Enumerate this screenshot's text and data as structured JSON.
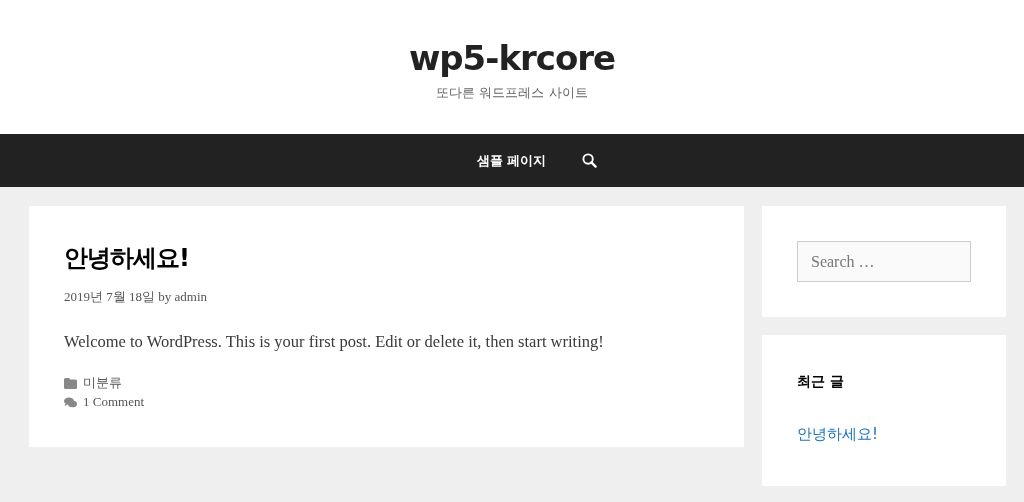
{
  "site": {
    "title": "wp5-krcore",
    "tagline": "또다른 워드프레스 사이트"
  },
  "nav": {
    "items": [
      {
        "label": "샘플 페이지"
      }
    ]
  },
  "post": {
    "title": "안녕하세요!",
    "meta": "2019년 7월 18일 by admin",
    "body": "Welcome to WordPress. This is your first post. Edit or delete it, then start writing!",
    "category": "미분류",
    "comments": "1 Comment"
  },
  "sidebar": {
    "search": {
      "placeholder": "Search …"
    },
    "recent": {
      "title": "최근 글",
      "items": [
        "안녕하세요!"
      ]
    }
  }
}
